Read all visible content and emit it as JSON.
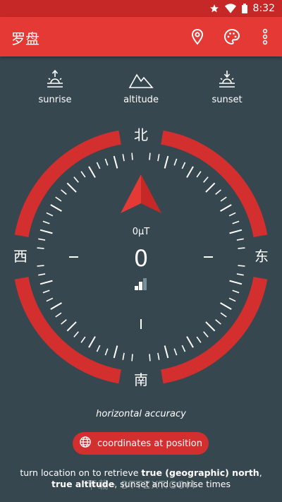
{
  "status_bar": {
    "time": "8:32",
    "icons": [
      "star-icon",
      "wifi-icon",
      "battery-icon"
    ]
  },
  "app_bar": {
    "title": "罗盘",
    "actions": [
      "location-pin-icon",
      "palette-icon",
      "more-vert-icon"
    ]
  },
  "quick_actions": [
    {
      "label": "sunrise",
      "icon": "sunrise-icon"
    },
    {
      "label": "altitude",
      "icon": "mountain-icon"
    },
    {
      "label": "sunset",
      "icon": "sunset-icon"
    }
  ],
  "compass": {
    "north": "北",
    "east": "东",
    "south": "南",
    "west": "西",
    "magnetic_field": "0μT",
    "heading": "0",
    "accent_color": "#d32f2f"
  },
  "accuracy_label": "horizontal accuracy",
  "coordinates_button": {
    "label": "coordinates at position",
    "icon": "globe-icon"
  },
  "message": {
    "part1": "turn location on to retrieve ",
    "bold1": "true (geographic) north",
    "part2": ", ",
    "bold2": "true altitude",
    "part3": ", sunset and sunrise times"
  },
  "watermark": "下载 · BTTZXT.COM"
}
